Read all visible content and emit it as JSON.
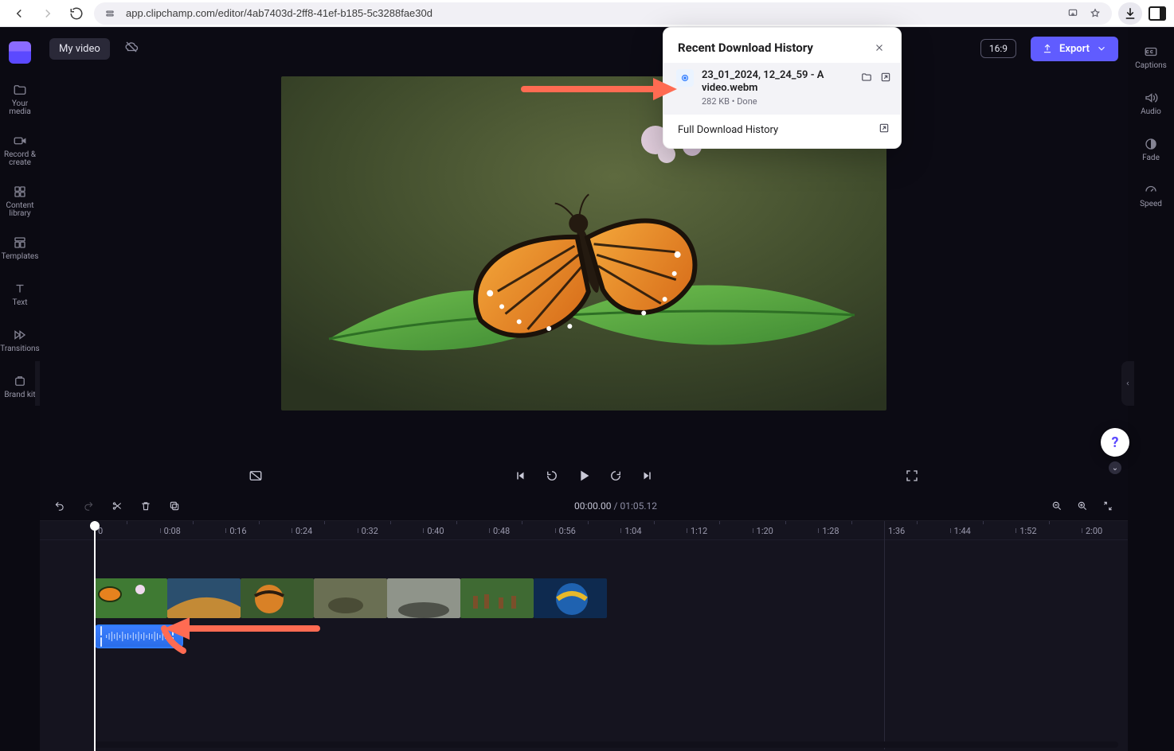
{
  "browser": {
    "url": "app.clipchamp.com/editor/4ab7403d-2ff8-41ef-b185-5c3288fae30d",
    "protocol_icon": "lock-icon"
  },
  "downloads": {
    "title": "Recent Download History",
    "file_line1": "23_01_2024, 12_24_59 - A",
    "file_line2": "video.webm",
    "size": "282 KB",
    "status": "Done",
    "full_history_label": "Full Download History"
  },
  "header": {
    "title": "My video",
    "export_label": "Export",
    "aspect_label": "16:9"
  },
  "left_nav": {
    "items": [
      {
        "label": "Your media"
      },
      {
        "label": "Record & create"
      },
      {
        "label": "Content library"
      },
      {
        "label": "Templates"
      },
      {
        "label": "Text"
      },
      {
        "label": "Transitions"
      },
      {
        "label": "Brand kit"
      }
    ]
  },
  "right_nav": {
    "items": [
      {
        "label": "Captions"
      },
      {
        "label": "Audio"
      },
      {
        "label": "Fade"
      },
      {
        "label": "Speed"
      }
    ]
  },
  "time": {
    "current": "00:00.00",
    "duration": "01:05.12"
  },
  "ruler_labels": [
    "0",
    "0:08",
    "0:16",
    "0:24",
    "0:32",
    "0:40",
    "0:48",
    "0:56",
    "1:04",
    "1:12",
    "1:20",
    "1:28",
    "1:36",
    "1:44",
    "1:52",
    "2:00"
  ]
}
